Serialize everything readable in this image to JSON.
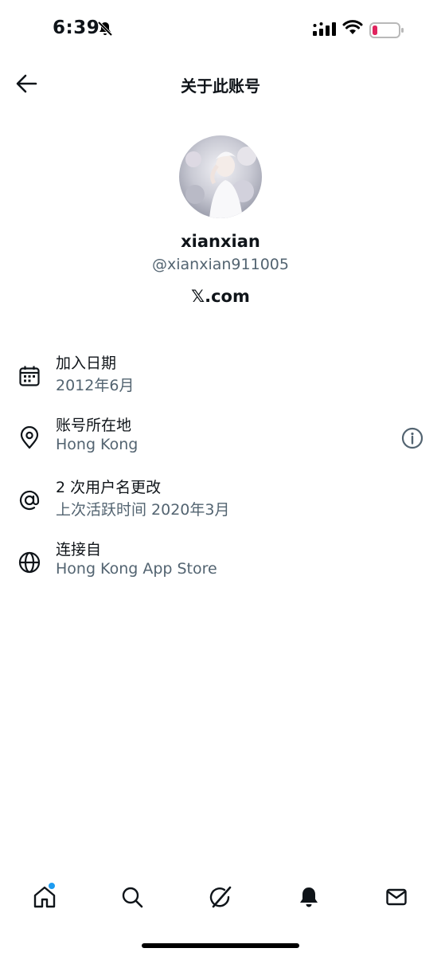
{
  "status_bar": {
    "time": "6:39",
    "icons": [
      "bell-slash-icon",
      "cellular-signal-icon",
      "wifi-icon",
      "battery-low-icon"
    ]
  },
  "header": {
    "title": "关于此账号",
    "back_icon": "arrow-left-icon"
  },
  "profile": {
    "display_name": "xianxian",
    "handle": "@xianxian911005",
    "platform": "𝕏.com"
  },
  "info": [
    {
      "icon": "calendar-icon",
      "title": "加入日期",
      "subtitle": "2012年6月"
    },
    {
      "icon": "location-pin-icon",
      "title": "账号所在地",
      "subtitle": "Hong Kong",
      "action_icon": "info-circle-icon"
    },
    {
      "icon": "at-sign-icon",
      "title": "2 次用户名更改",
      "subtitle": "上次活跃时间 2020年3月"
    },
    {
      "icon": "globe-icon",
      "title": "连接自",
      "subtitle": "Hong Kong App Store"
    }
  ],
  "bottom_nav": {
    "items": [
      "home-icon",
      "search-icon",
      "grok-icon",
      "notifications-bell-icon",
      "messages-envelope-icon"
    ],
    "home_has_badge": true,
    "badge_color": "#1d9bf0"
  },
  "colors": {
    "text_primary": "#0f1419",
    "text_secondary": "#536471",
    "battery_low": "#e0245e"
  }
}
